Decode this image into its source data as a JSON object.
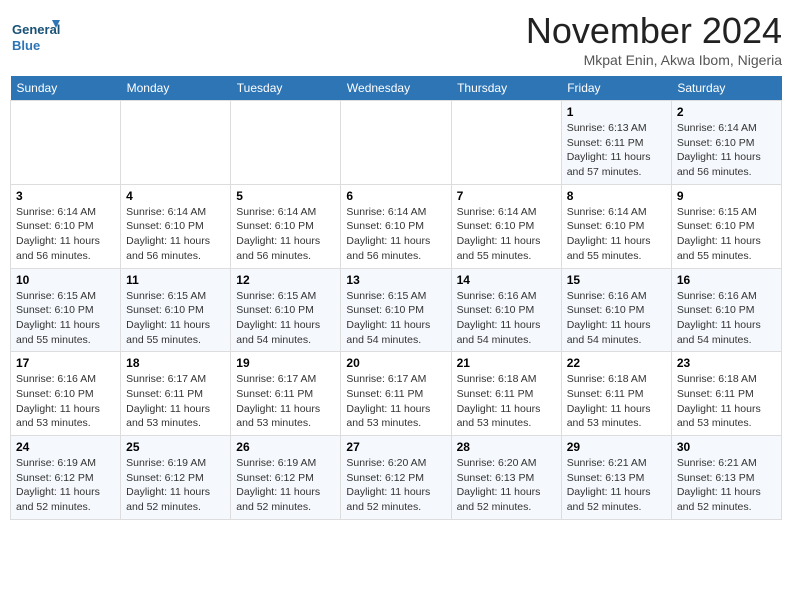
{
  "logo": {
    "line1": "General",
    "line2": "Blue"
  },
  "title": "November 2024",
  "subtitle": "Mkpat Enin, Akwa Ibom, Nigeria",
  "days_of_week": [
    "Sunday",
    "Monday",
    "Tuesday",
    "Wednesday",
    "Thursday",
    "Friday",
    "Saturday"
  ],
  "weeks": [
    [
      {
        "day": "",
        "info": ""
      },
      {
        "day": "",
        "info": ""
      },
      {
        "day": "",
        "info": ""
      },
      {
        "day": "",
        "info": ""
      },
      {
        "day": "",
        "info": ""
      },
      {
        "day": "1",
        "info": "Sunrise: 6:13 AM\nSunset: 6:11 PM\nDaylight: 11 hours\nand 57 minutes."
      },
      {
        "day": "2",
        "info": "Sunrise: 6:14 AM\nSunset: 6:10 PM\nDaylight: 11 hours\nand 56 minutes."
      }
    ],
    [
      {
        "day": "3",
        "info": "Sunrise: 6:14 AM\nSunset: 6:10 PM\nDaylight: 11 hours\nand 56 minutes."
      },
      {
        "day": "4",
        "info": "Sunrise: 6:14 AM\nSunset: 6:10 PM\nDaylight: 11 hours\nand 56 minutes."
      },
      {
        "day": "5",
        "info": "Sunrise: 6:14 AM\nSunset: 6:10 PM\nDaylight: 11 hours\nand 56 minutes."
      },
      {
        "day": "6",
        "info": "Sunrise: 6:14 AM\nSunset: 6:10 PM\nDaylight: 11 hours\nand 56 minutes."
      },
      {
        "day": "7",
        "info": "Sunrise: 6:14 AM\nSunset: 6:10 PM\nDaylight: 11 hours\nand 55 minutes."
      },
      {
        "day": "8",
        "info": "Sunrise: 6:14 AM\nSunset: 6:10 PM\nDaylight: 11 hours\nand 55 minutes."
      },
      {
        "day": "9",
        "info": "Sunrise: 6:15 AM\nSunset: 6:10 PM\nDaylight: 11 hours\nand 55 minutes."
      }
    ],
    [
      {
        "day": "10",
        "info": "Sunrise: 6:15 AM\nSunset: 6:10 PM\nDaylight: 11 hours\nand 55 minutes."
      },
      {
        "day": "11",
        "info": "Sunrise: 6:15 AM\nSunset: 6:10 PM\nDaylight: 11 hours\nand 55 minutes."
      },
      {
        "day": "12",
        "info": "Sunrise: 6:15 AM\nSunset: 6:10 PM\nDaylight: 11 hours\nand 54 minutes."
      },
      {
        "day": "13",
        "info": "Sunrise: 6:15 AM\nSunset: 6:10 PM\nDaylight: 11 hours\nand 54 minutes."
      },
      {
        "day": "14",
        "info": "Sunrise: 6:16 AM\nSunset: 6:10 PM\nDaylight: 11 hours\nand 54 minutes."
      },
      {
        "day": "15",
        "info": "Sunrise: 6:16 AM\nSunset: 6:10 PM\nDaylight: 11 hours\nand 54 minutes."
      },
      {
        "day": "16",
        "info": "Sunrise: 6:16 AM\nSunset: 6:10 PM\nDaylight: 11 hours\nand 54 minutes."
      }
    ],
    [
      {
        "day": "17",
        "info": "Sunrise: 6:16 AM\nSunset: 6:10 PM\nDaylight: 11 hours\nand 53 minutes."
      },
      {
        "day": "18",
        "info": "Sunrise: 6:17 AM\nSunset: 6:11 PM\nDaylight: 11 hours\nand 53 minutes."
      },
      {
        "day": "19",
        "info": "Sunrise: 6:17 AM\nSunset: 6:11 PM\nDaylight: 11 hours\nand 53 minutes."
      },
      {
        "day": "20",
        "info": "Sunrise: 6:17 AM\nSunset: 6:11 PM\nDaylight: 11 hours\nand 53 minutes."
      },
      {
        "day": "21",
        "info": "Sunrise: 6:18 AM\nSunset: 6:11 PM\nDaylight: 11 hours\nand 53 minutes."
      },
      {
        "day": "22",
        "info": "Sunrise: 6:18 AM\nSunset: 6:11 PM\nDaylight: 11 hours\nand 53 minutes."
      },
      {
        "day": "23",
        "info": "Sunrise: 6:18 AM\nSunset: 6:11 PM\nDaylight: 11 hours\nand 53 minutes."
      }
    ],
    [
      {
        "day": "24",
        "info": "Sunrise: 6:19 AM\nSunset: 6:12 PM\nDaylight: 11 hours\nand 52 minutes."
      },
      {
        "day": "25",
        "info": "Sunrise: 6:19 AM\nSunset: 6:12 PM\nDaylight: 11 hours\nand 52 minutes."
      },
      {
        "day": "26",
        "info": "Sunrise: 6:19 AM\nSunset: 6:12 PM\nDaylight: 11 hours\nand 52 minutes."
      },
      {
        "day": "27",
        "info": "Sunrise: 6:20 AM\nSunset: 6:12 PM\nDaylight: 11 hours\nand 52 minutes."
      },
      {
        "day": "28",
        "info": "Sunrise: 6:20 AM\nSunset: 6:13 PM\nDaylight: 11 hours\nand 52 minutes."
      },
      {
        "day": "29",
        "info": "Sunrise: 6:21 AM\nSunset: 6:13 PM\nDaylight: 11 hours\nand 52 minutes."
      },
      {
        "day": "30",
        "info": "Sunrise: 6:21 AM\nSunset: 6:13 PM\nDaylight: 11 hours\nand 52 minutes."
      }
    ]
  ]
}
